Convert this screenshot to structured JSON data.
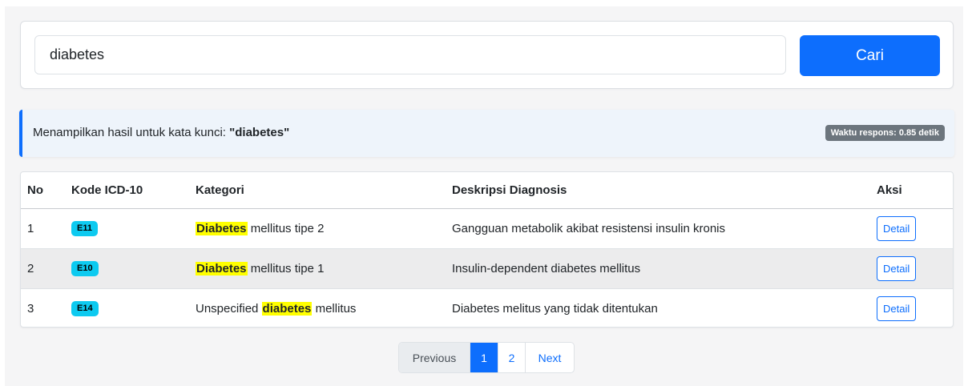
{
  "search": {
    "value": "diabetes",
    "button_label": "Cari"
  },
  "info": {
    "prefix": "Menampilkan hasil untuk kata kunci: ",
    "keyword": "\"diabetes\"",
    "response_time": "Waktu respons: 0.85 detik"
  },
  "table": {
    "headers": {
      "no": "No",
      "code": "Kode ICD-10",
      "category": "Kategori",
      "description": "Deskripsi Diagnosis",
      "action": "Aksi"
    },
    "rows": [
      {
        "no": "1",
        "code": "E11",
        "category_pre": "",
        "category_highlight": "Diabetes",
        "category_post": " mellitus tipe 2",
        "description": "Gangguan metabolik akibat resistensi insulin kronis",
        "action": "Detail"
      },
      {
        "no": "2",
        "code": "E10",
        "category_pre": "",
        "category_highlight": "Diabetes",
        "category_post": " mellitus tipe 1",
        "description": "Insulin-dependent diabetes mellitus",
        "action": "Detail"
      },
      {
        "no": "3",
        "code": "E14",
        "category_pre": "Unspecified ",
        "category_highlight": "diabetes",
        "category_post": " mellitus",
        "description": "Diabetes melitus yang tidak ditentukan",
        "action": "Detail"
      }
    ]
  },
  "pagination": {
    "previous": "Previous",
    "pages": [
      "1",
      "2"
    ],
    "active_page": "1",
    "next": "Next"
  },
  "colors": {
    "primary": "#0d6efd",
    "badge_code": "#0dcaf0",
    "highlight": "#ffff00",
    "badge_time": "#6c757d"
  }
}
